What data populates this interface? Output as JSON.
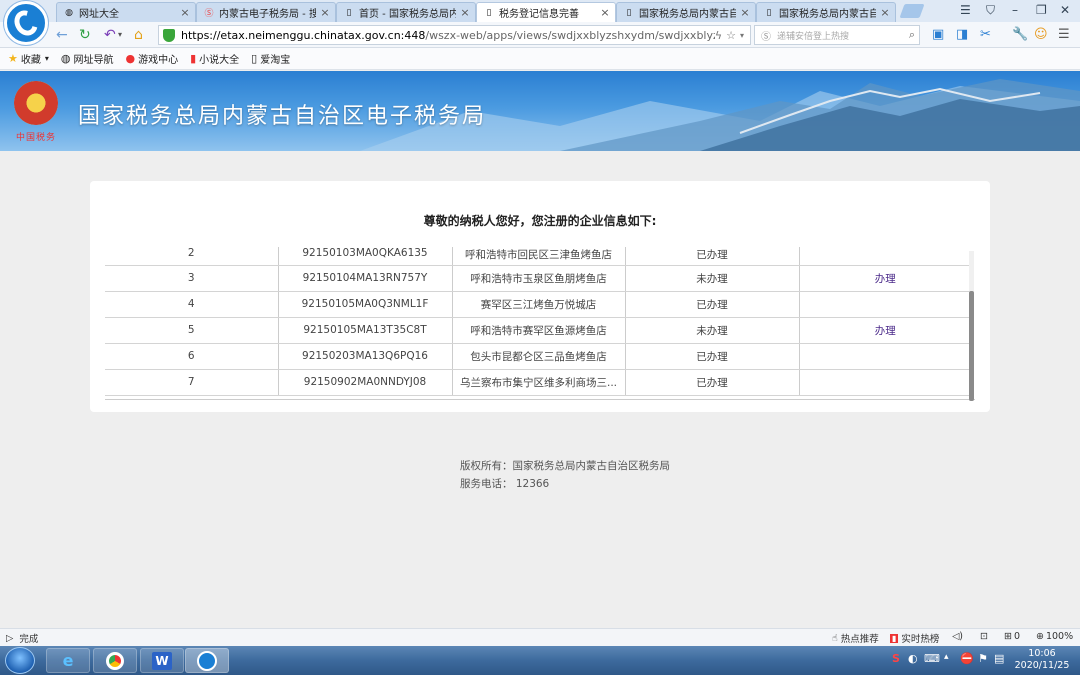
{
  "browser": {
    "tabs": [
      {
        "title": "网址大全",
        "icon": "globe-icon",
        "active": false
      },
      {
        "title": "内蒙古电子税务局 - 搜狗",
        "icon": "sogou-icon",
        "active": false
      },
      {
        "title": "首页 - 国家税务总局内蒙",
        "icon": "page-icon",
        "active": false
      },
      {
        "title": "税务登记信息完善",
        "icon": "page-icon",
        "active": true
      },
      {
        "title": "国家税务总局内蒙古自治",
        "icon": "page-icon",
        "active": false
      },
      {
        "title": "国家税务总局内蒙古自治",
        "icon": "page-icon",
        "active": false
      }
    ],
    "url_host": "https://etax.neimenggu.chinatax.gov.cn:448",
    "url_path": "/wszx-web/apps/views/swdjxxblyzshxydm/swdjxxblyzshxyd",
    "search_placeholder": "递辅安倍登上热搜"
  },
  "bookmarks": [
    {
      "label": "收藏",
      "icon": "star-icon"
    },
    {
      "label": "网址导航",
      "icon": "globe-icon"
    },
    {
      "label": "游戏中心",
      "icon": "game-icon"
    },
    {
      "label": "小说大全",
      "icon": "book-icon"
    },
    {
      "label": "爱淘宝",
      "icon": "page-icon"
    }
  ],
  "banner": {
    "title": "国家税务总局内蒙古自治区电子税务局",
    "emblem_caption": "中国税务"
  },
  "main": {
    "heading": "尊敬的纳税人您好，您注册的企业信息如下:",
    "rows": [
      {
        "no": "2",
        "credit_code": "92150103MA0QKA6135",
        "name": "呼和浩特市回民区三津鱼烤鱼店",
        "status": "已办理",
        "action": ""
      },
      {
        "no": "3",
        "credit_code": "92150104MA13RN757Y",
        "name": "呼和浩特市玉泉区鱼朋烤鱼店",
        "status": "未办理",
        "action": "办理"
      },
      {
        "no": "4",
        "credit_code": "92150105MA0Q3NML1F",
        "name": "赛罕区三江烤鱼万悦城店",
        "status": "已办理",
        "action": ""
      },
      {
        "no": "5",
        "credit_code": "92150105MA13T35C8T",
        "name": "呼和浩特市赛罕区鱼源烤鱼店",
        "status": "未办理",
        "action": "办理"
      },
      {
        "no": "6",
        "credit_code": "92150203MA13Q6PQ16",
        "name": "包头市昆都仑区三品鱼烤鱼店",
        "status": "已办理",
        "action": ""
      },
      {
        "no": "7",
        "credit_code": "92150902MA0NNDYJ08",
        "name": "乌兰察布市集宁区维多利商场三...",
        "status": "已办理",
        "action": ""
      }
    ]
  },
  "footer": {
    "copyright": "版权所有：国家税务总局内蒙古自治区税务局",
    "phone": "服务电话： 12366"
  },
  "statusbar": {
    "status": "完成",
    "hot_recommend": "热点推荐",
    "live_hot": "实时热榜",
    "download_count": "0",
    "zoom": "100%"
  },
  "taskbar": {
    "time": "10:06",
    "date": "2020/11/25"
  }
}
